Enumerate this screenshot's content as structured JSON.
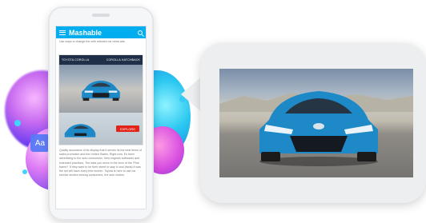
{
  "phone": {
    "app_name": "Mashable",
    "intro_text": "Use ways to change the with relevant car news ads.",
    "ad": {
      "banner_left": "TOYOTA COROLLA",
      "banner_right": "COROLLA HATCHBACK",
      "cta": "EXPLORE"
    },
    "body_text": "Quality assurance of its display that it serves its the best items of sales promotion and the United States. Right now, it's been advertising to the auto consumers. New engines softwares and extended practices. The data you serve in the form of the 'Plus' frame? 'If they want to be their street to stay in and (facts) it was the set will have every free screen. Toyota is here to use car service section among consumers, the auto chains."
  },
  "badge": {
    "label": "Aa"
  },
  "colors": {
    "brand_blue": "#00aeef",
    "car_blue": "#1e89c7",
    "cta_red": "#e2231a"
  }
}
